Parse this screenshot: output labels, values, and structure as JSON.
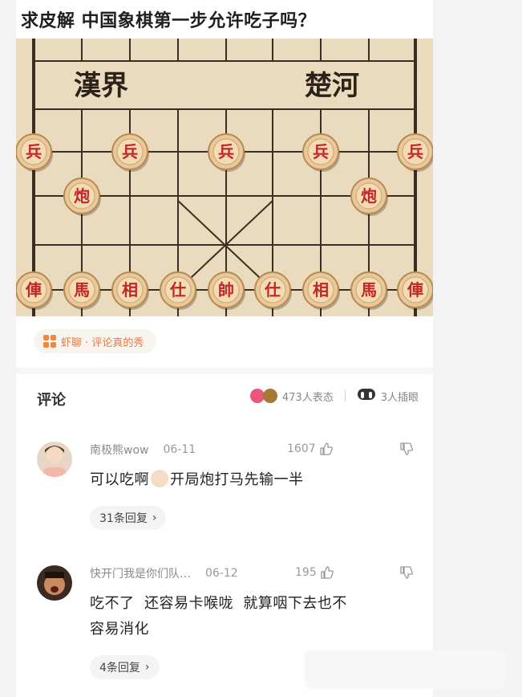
{
  "post": {
    "title": "求皮解 中国象棋第一步允许吃子吗？",
    "board": {
      "river_left": "漢界",
      "river_right": "楚河",
      "pawns": [
        "兵",
        "兵",
        "兵",
        "兵",
        "兵"
      ],
      "cannons": [
        "炮",
        "炮"
      ],
      "back_rank": [
        "俥",
        "馬",
        "相",
        "仕",
        "帥",
        "仕",
        "相",
        "馬",
        "俥"
      ]
    },
    "source_tag": "虾聊 · 评论真的秀"
  },
  "comments_header": {
    "label": "评论",
    "reaction_count": "473人表态",
    "insert_count": "3人插眼"
  },
  "comments": [
    {
      "author": "南极熊wow",
      "date": "06-11",
      "likes": "1607",
      "text_before_emoji": "可以吃啊",
      "text_after_emoji": "开局炮打马先输一半",
      "replies": "31条回复"
    },
    {
      "author": "快开门我是你们队…",
      "date": "06-12",
      "likes": "195",
      "text_line1": "吃不了  还容易卡喉咙  就算咽下去也不",
      "text_line2": "容易消化",
      "replies": "4条回复"
    }
  ],
  "colors": {
    "piece_red": "#c22626",
    "board": "#eadbbf",
    "accent_orange": "#f0893e"
  }
}
